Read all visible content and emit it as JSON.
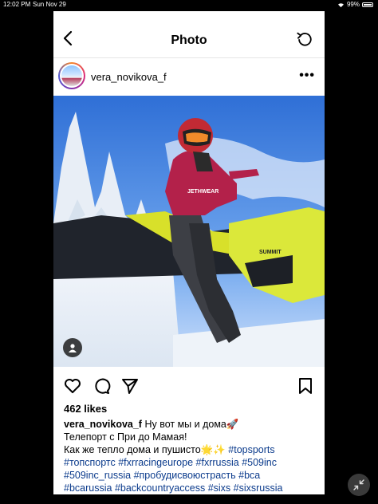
{
  "status_bar": {
    "time": "12:02 PM",
    "date": "Sun Nov 29",
    "battery": "99%"
  },
  "nav": {
    "title": "Photo"
  },
  "post": {
    "username": "vera_novikova_f",
    "likes": "462 likes",
    "caption": {
      "author": "vera_novikova_f",
      "line1_text": " Ну вот мы и дома🚀",
      "line2": "Телепорт с При до Мамая!",
      "line3_text": "Как же тепло дома и пушисто🌟✨ ",
      "line3_tag": "#topsports",
      "line4_tags": [
        "#топспортс",
        "#fxrracingeurope",
        "#fxrrussia",
        "#509inc"
      ],
      "line5_tags": [
        "#509inc_russia",
        "#пробудисвоюстрасть",
        "#bca"
      ],
      "line6_tags": [
        "#bcarussia",
        "#backcountryaccess",
        "#sixs",
        "#sixsrussia"
      ]
    }
  },
  "icons": [
    "back-arrow-icon",
    "refresh-icon",
    "more-icon",
    "user-tag-icon",
    "heart-icon",
    "comment-icon",
    "share-icon",
    "bookmark-icon",
    "collapse-icon"
  ],
  "colors": {
    "hashtag": "#0b3b8c",
    "background": "#000000"
  }
}
